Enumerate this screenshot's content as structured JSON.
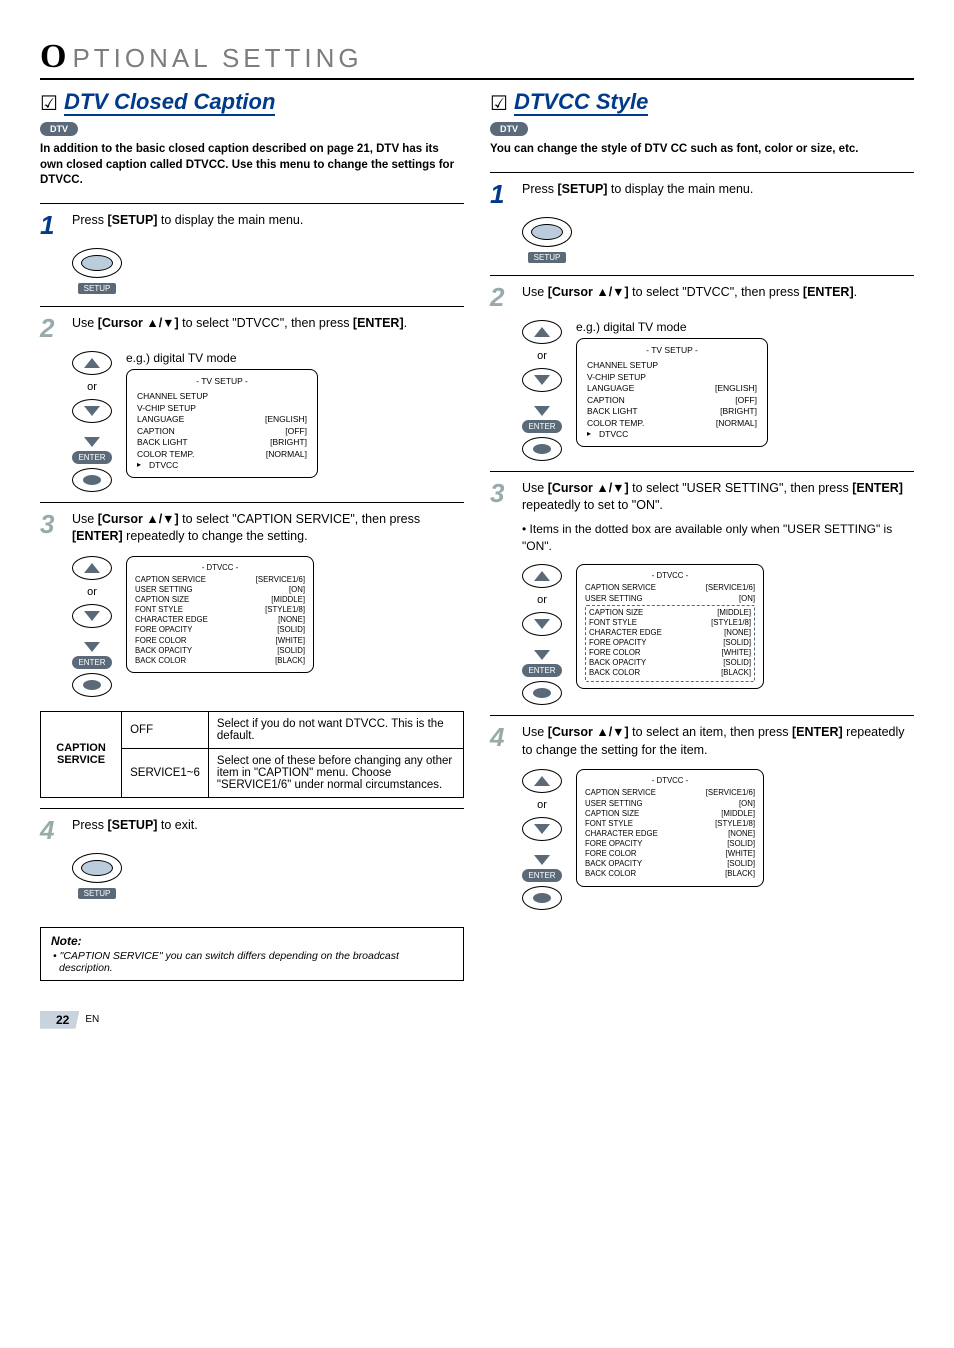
{
  "chapter": {
    "letter": "O",
    "rest": "PTIONAL  SETTING"
  },
  "left": {
    "heading": "DTV Closed Caption",
    "dtv_label": "DTV",
    "intro": "In addition to the basic closed caption described on page 21, DTV has its own closed caption called DTVCC. Use this menu to change the settings for DTVCC.",
    "step1_text_a": "Press ",
    "step1_key": "[SETUP]",
    "step1_text_b": " to display the main menu.",
    "setup_label": "SETUP",
    "step2_a": "Use ",
    "step2_key1": "[Cursor ▲/▼]",
    "step2_b": " to select \"DTVCC\", then press ",
    "step2_key2": "[ENTER]",
    "step2_c": ".",
    "nav_or": "or",
    "enter_label": "ENTER",
    "eg_label": "e.g.) digital TV mode",
    "tv_panel": {
      "hdr": "-   TV SETUP   -",
      "rows": [
        {
          "k": "CHANNEL SETUP",
          "v": ""
        },
        {
          "k": "V-CHIP  SETUP",
          "v": ""
        },
        {
          "k": "LANGUAGE",
          "v": "[ENGLISH]"
        },
        {
          "k": "CAPTION",
          "v": "[OFF]"
        },
        {
          "k": "BACK  LIGHT",
          "v": "[BRIGHT]"
        },
        {
          "k": "COLOR  TEMP.",
          "v": "[NORMAL]"
        },
        {
          "k": "DTVCC",
          "v": "",
          "ptr": true
        }
      ]
    },
    "step3_a": "Use ",
    "step3_key1": "[Cursor ▲/▼]",
    "step3_b": " to select \"CAPTION SERVICE\", then press ",
    "step3_key2": "[ENTER]",
    "step3_c": " repeatedly to change the setting.",
    "dtvcc_panel": {
      "hdr": "- DTVCC -",
      "rows": [
        {
          "k": "CAPTION SERVICE",
          "v": "[SERVICE1/6]",
          "ptr": true
        },
        {
          "k": "USER SETTING",
          "v": "[ON]"
        },
        {
          "k": "CAPTION SIZE",
          "v": "[MIDDLE]"
        },
        {
          "k": "FONT STYLE",
          "v": "[STYLE1/8]"
        },
        {
          "k": "CHARACTER EDGE",
          "v": "[NONE]"
        },
        {
          "k": "FORE OPACITY",
          "v": "[SOLID]"
        },
        {
          "k": "FORE COLOR",
          "v": "[WHITE]"
        },
        {
          "k": "BACK OPACITY",
          "v": "[SOLID]"
        },
        {
          "k": "BACK COLOR",
          "v": "[BLACK]"
        }
      ]
    },
    "table": {
      "label": "CAPTION SERVICE",
      "row1_opt": "OFF",
      "row1_desc": "Select if you do not want DTVCC. This is the default.",
      "row2_opt": "SERVICE1~6",
      "row2_desc": "Select one of these before changing any other item in \"CAPTION\" menu. Choose \"SERVICE1/6\" under normal circumstances."
    },
    "step4_a": "Press ",
    "step4_key": "[SETUP]",
    "step4_b": " to exit.",
    "note_hdr": "Note:",
    "note_body": "• \"CAPTION SERVICE\" you can switch differs depending on the broadcast description."
  },
  "right": {
    "heading": "DTVCC Style",
    "dtv_label": "DTV",
    "intro": "You can change the style of DTV CC such as font, color or size, etc.",
    "step1_text_a": "Press ",
    "step1_key": "[SETUP]",
    "step1_text_b": " to display the main menu.",
    "setup_label": "SETUP",
    "step2_a": "Use ",
    "step2_key1": "[Cursor ▲/▼]",
    "step2_b": " to select \"DTVCC\", then press ",
    "step2_key2": "[ENTER]",
    "step2_c": ".",
    "nav_or": "or",
    "enter_label": "ENTER",
    "eg_label": "e.g.) digital TV mode",
    "tv_panel": {
      "hdr": "-   TV SETUP   -",
      "rows": [
        {
          "k": "CHANNEL SETUP",
          "v": ""
        },
        {
          "k": "V-CHIP  SETUP",
          "v": ""
        },
        {
          "k": "LANGUAGE",
          "v": "[ENGLISH]"
        },
        {
          "k": "CAPTION",
          "v": "[OFF]"
        },
        {
          "k": "BACK  LIGHT",
          "v": "[BRIGHT]"
        },
        {
          "k": "COLOR  TEMP.",
          "v": "[NORMAL]"
        },
        {
          "k": "DTVCC",
          "v": "",
          "ptr": true
        }
      ]
    },
    "step3_a": "Use ",
    "step3_key1": "[Cursor ▲/▼]",
    "step3_b": " to select \"USER SETTING\", then press ",
    "step3_key2": "[ENTER]",
    "step3_c": " repeatedly to set to \"ON\".",
    "step3_note": "• Items in the dotted box are available only when \"USER SETTING\" is \"ON\".",
    "dtvcc_panel3": {
      "hdr": "- DTVCC -",
      "top": [
        {
          "k": "CAPTION SERVICE",
          "v": "[SERVICE1/6]"
        },
        {
          "k": "USER SETTING",
          "v": "[ON]",
          "ptr": true
        }
      ],
      "boxed": [
        {
          "k": "CAPTION SIZE",
          "v": "[MIDDLE]"
        },
        {
          "k": "FONT STYLE",
          "v": "[STYLE1/8]"
        },
        {
          "k": "CHARACTER EDGE",
          "v": "[NONE]"
        },
        {
          "k": "FORE OPACITY",
          "v": "[SOLID]"
        },
        {
          "k": "FORE COLOR",
          "v": "[WHITE]"
        },
        {
          "k": "BACK OPACITY",
          "v": "[SOLID]"
        },
        {
          "k": "BACK COLOR",
          "v": "[BLACK]"
        }
      ]
    },
    "step4_a": "Use ",
    "step4_key1": "[Cursor ▲/▼]",
    "step4_b": " to select an item, then press ",
    "step4_key2": "[ENTER]",
    "step4_c": " repeatedly to change the setting for the item.",
    "dtvcc_panel4": {
      "hdr": "- DTVCC -",
      "rows": [
        {
          "k": "CAPTION SERVICE",
          "v": "[SERVICE1/6]"
        },
        {
          "k": "USER SETTING",
          "v": "[ON]"
        },
        {
          "k": "CAPTION SIZE",
          "v": "[MIDDLE]",
          "ptr": true
        },
        {
          "k": "FONT STYLE",
          "v": "[STYLE1/8]"
        },
        {
          "k": "CHARACTER EDGE",
          "v": "[NONE]"
        },
        {
          "k": "FORE OPACITY",
          "v": "[SOLID]"
        },
        {
          "k": "FORE COLOR",
          "v": "[WHITE]"
        },
        {
          "k": "BACK OPACITY",
          "v": "[SOLID]"
        },
        {
          "k": "BACK COLOR",
          "v": "[BLACK]"
        }
      ]
    }
  },
  "footer": {
    "page": "22",
    "en": "EN"
  }
}
